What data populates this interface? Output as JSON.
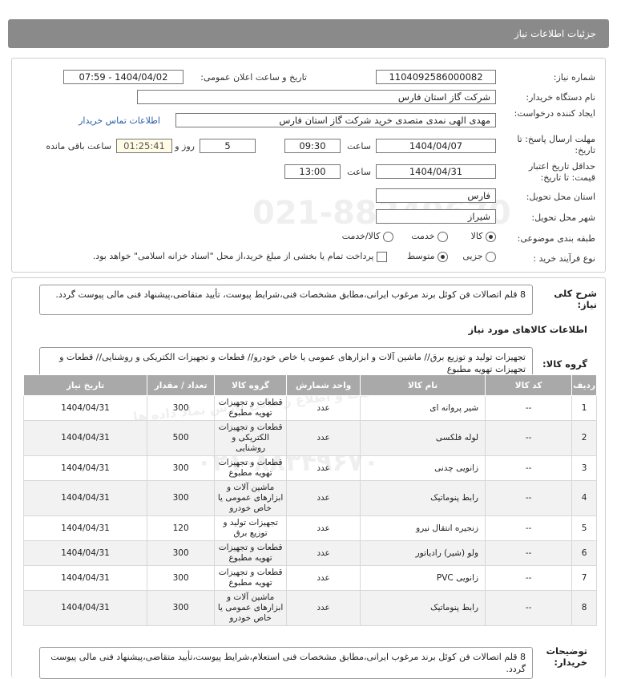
{
  "header": {
    "title": "جزئیات اطلاعات نیاز"
  },
  "form": {
    "need_number_label": "شماره نیاز:",
    "need_number": "1104092586000082",
    "announce_label": "تاریخ و ساعت اعلان عمومی:",
    "announce_value": "1404/04/02 - 07:59",
    "buyer_label": "نام دستگاه خریدار:",
    "buyer_value": "شرکت گاز استان فارس",
    "creator_label": "ایجاد کننده درخواست:",
    "creator_value": "مهدی الهی نمدی متصدی خرید شرکت گاز استان فارس",
    "contact_link": "اطلاعات تماس خریدار",
    "deadline_label": "مهلت ارسال پاسخ: تا تاریخ:",
    "deadline_date": "1404/04/07",
    "time_label": "ساعت",
    "deadline_time": "09:30",
    "days_value": "5",
    "days_label": "روز و",
    "remaining_time": "01:25:41",
    "remaining_label": "ساعت باقی مانده",
    "validity_label": "حداقل تاریخ اعتبار قیمت: تا تاریخ:",
    "validity_date": "1404/04/31",
    "validity_time": "13:00",
    "province_label": "استان محل تحویل:",
    "province_value": "فارس",
    "city_label": "شهر محل تحویل:",
    "city_value": "شیراز",
    "category_label": "طبقه بندی موضوعی:",
    "category_options": [
      "کالا",
      "خدمت",
      "کالا/خدمت"
    ],
    "purchase_label": "نوع فرآیند خرید :",
    "purchase_options": [
      "جزیی",
      "متوسط"
    ],
    "payment_note": "پرداخت تمام یا بخشی از مبلغ خرید،از محل \"اسناد خزانه اسلامی\" خواهد بود."
  },
  "details": {
    "summary_label": "شرح کلی نیاز:",
    "summary_text": "8 قلم اتصالات فن کوئل برند مرغوب ایرانی،مطابق مشخصات فنی،شرایط پیوست، تأیید متقاضی،پیشنهاد فنی مالی پیوست گردد.",
    "goods_info_title": "اطلاعات کالاهای مورد نیاز",
    "group_label": "گروه کالا:",
    "group_text": "تجهیزات تولید و توزیع برق// ماشین آلات و ابزارهای عمومی یا خاص خودرو// قطعات و تجهیزات الکتریکی و روشنایی// قطعات و تجهیزات تهویه مطبوع",
    "buyer_notes_label": "توضیحات خریدار:",
    "buyer_notes_text": "8 قلم اتصالات فن کوئل برند مرغوب ایرانی،مطابق مشخصات فنی استعلام،شرایط پیوست،تأیید متقاضی،پیشنهاد فنی مالی پیوست گردد."
  },
  "table": {
    "headers": [
      "ردیف",
      "کد کالا",
      "نام کالا",
      "واحد شمارش",
      "گروه کالا",
      "تعداد / مقدار",
      "تاریخ نیاز"
    ],
    "rows": [
      [
        "1",
        "--",
        "شیر پروانه ای",
        "عدد",
        "قطعات و تجهیزات تهویه مطبوع",
        "300",
        "1404/04/31"
      ],
      [
        "2",
        "--",
        "لوله فلکسی",
        "عدد",
        "قطعات و تجهیزات الکتریکی و روشنایی",
        "500",
        "1404/04/31"
      ],
      [
        "3",
        "--",
        "زانویی چدنی",
        "عدد",
        "قطعات و تجهیزات تهویه مطبوع",
        "300",
        "1404/04/31"
      ],
      [
        "4",
        "--",
        "رابط پنوماتیک",
        "عدد",
        "ماشین آلات و ابزارهای عمومی یا خاص خودرو",
        "300",
        "1404/04/31"
      ],
      [
        "5",
        "--",
        "زنجیره انتقال نیرو",
        "عدد",
        "تجهیزات تولید و توزیع برق",
        "120",
        "1404/04/31"
      ],
      [
        "6",
        "--",
        "ولو (شیر) رادیاتور",
        "عدد",
        "قطعات و تجهیزات تهویه مطبوع",
        "300",
        "1404/04/31"
      ],
      [
        "7",
        "--",
        "زانویی PVC",
        "عدد",
        "قطعات و تجهیزات تهویه مطبوع",
        "300",
        "1404/04/31"
      ],
      [
        "8",
        "--",
        "رابط پنوماتیک",
        "عدد",
        "ماشین آلات و ابزارهای عمومی یا خاص خودرو",
        "300",
        "1404/04/31"
      ]
    ]
  },
  "watermark": {
    "phone_top": "021-88349670",
    "phone_bottom": "۰۲۱-۸۸۳۴۹۶۷۰",
    "site_name": "پایگاه اطلاع رسانی مناقصه و مزایده",
    "center_name": "مرکز فن آوری اطلاعات و اطلاع رسانی پارس نماد داده ها"
  }
}
